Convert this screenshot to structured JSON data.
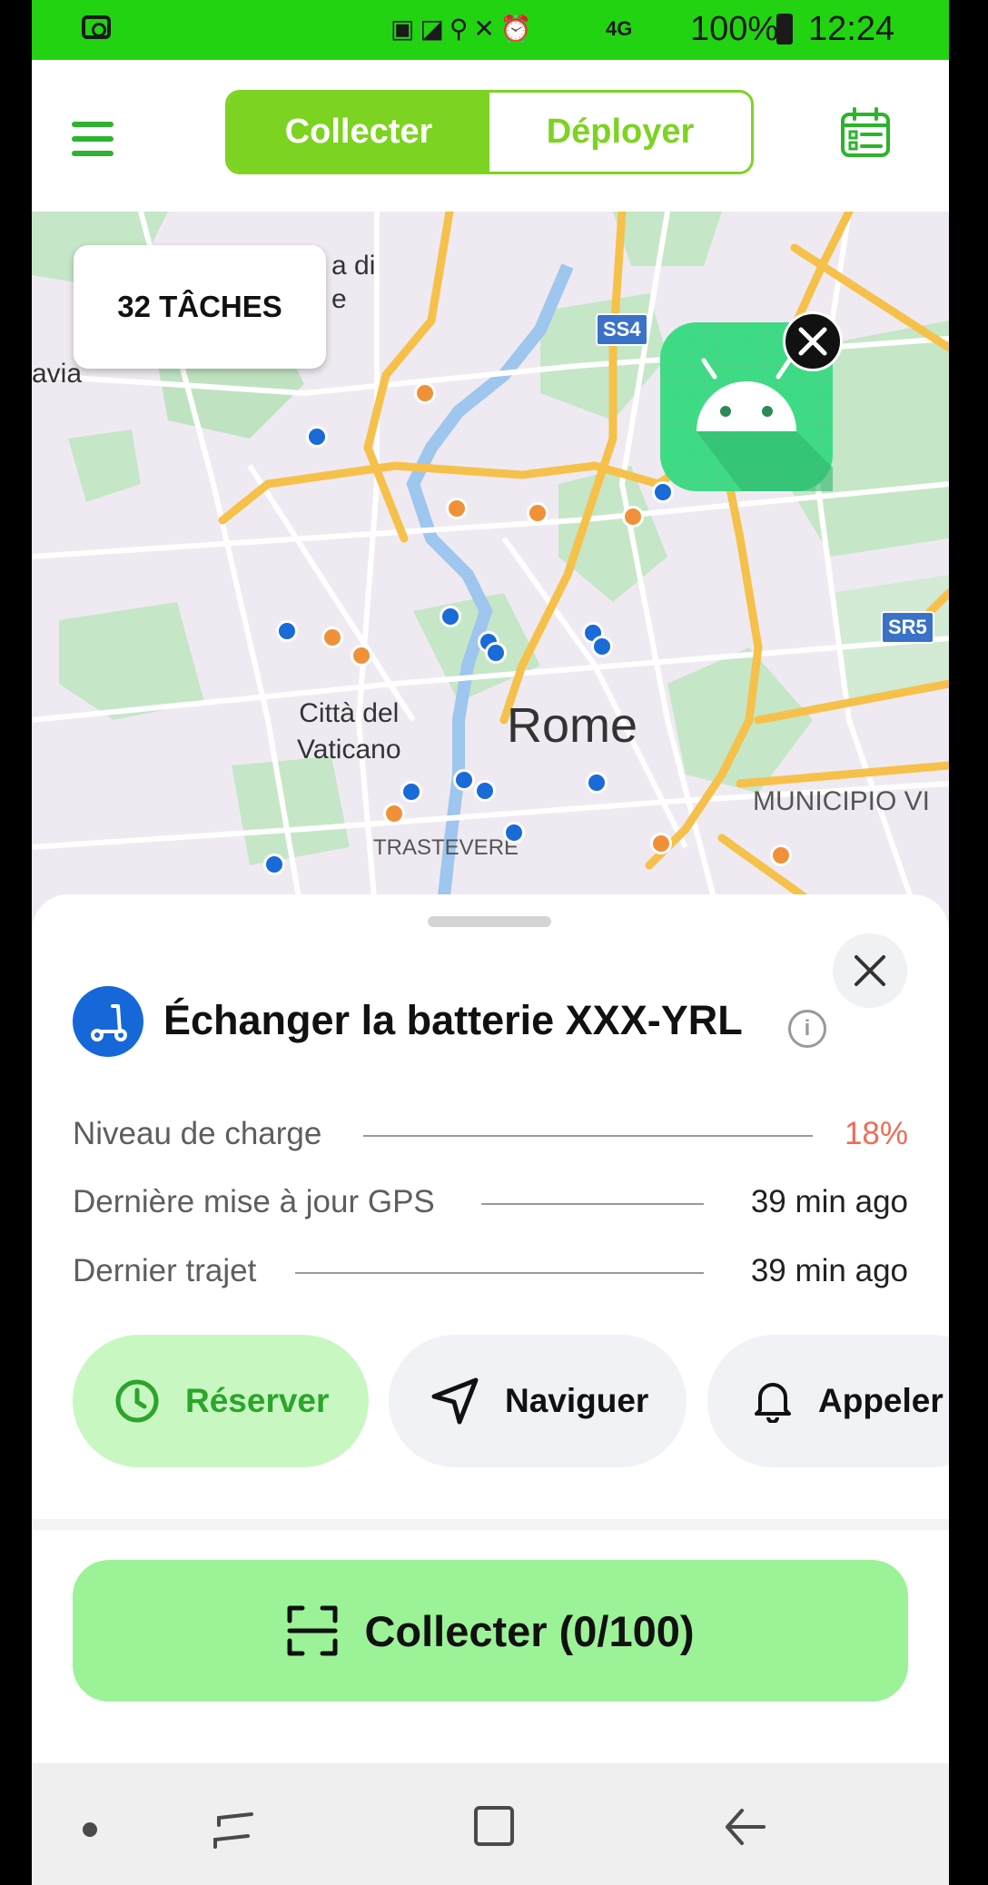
{
  "status_bar": {
    "network": "4G",
    "battery": "100%",
    "time": "12:24"
  },
  "header": {
    "tab_collect": "Collecter",
    "tab_deploy": "Déployer",
    "active_tab": "Collecter",
    "accent_color": "#7dd321"
  },
  "map": {
    "tasks_badge": "32 TÂCHES",
    "labels": {
      "city": "Rome",
      "vatican": "Città del\nVaticano",
      "trastevere": "TRASTEVERE",
      "municipio": "MUNICIPIO VI",
      "partial_1": "a di",
      "partial_2": "e",
      "partial_3": "avia"
    },
    "road_shields": [
      "SS4",
      "SR5"
    ],
    "marker_colors": {
      "blue": "#1a6ad8",
      "orange": "#f0913a"
    }
  },
  "task": {
    "title": "Échanger la batterie XXX-YRL",
    "vehicle_icon": "scooter-icon",
    "rows": [
      {
        "label": "Niveau de charge",
        "value": "18%"
      },
      {
        "label": "Dernière mise à jour GPS",
        "value": "39 min ago"
      },
      {
        "label": "Dernier trajet",
        "value": "39 min ago"
      }
    ]
  },
  "actions": {
    "reserve": "Réserver",
    "navigate": "Naviguer",
    "call": "Appeler"
  },
  "collect_button": "Collecter (0/100)"
}
